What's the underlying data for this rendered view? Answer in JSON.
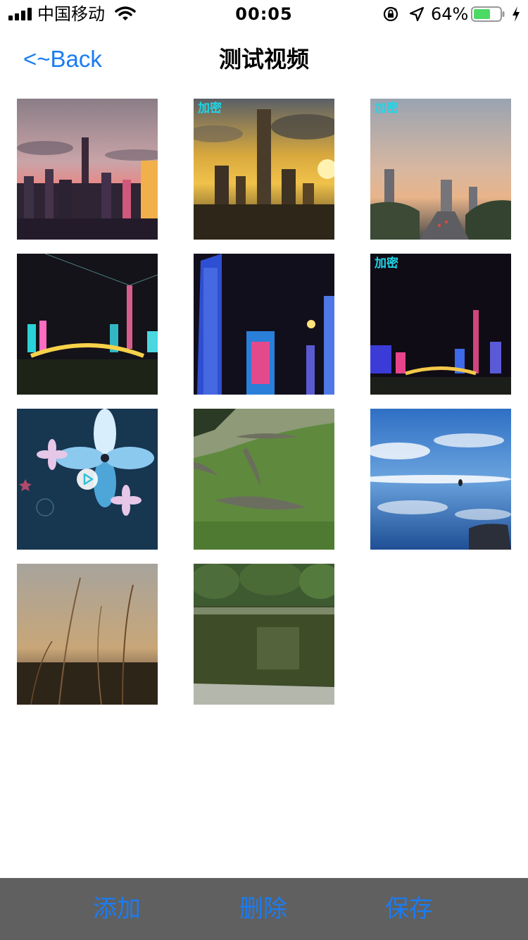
{
  "status_bar": {
    "carrier": "中国移动",
    "time": "00:05",
    "battery_percent": "64%",
    "battery_level": 0.64,
    "icons": [
      "signal-icon",
      "wifi-icon",
      "rotation-lock-icon",
      "location-icon",
      "battery-icon",
      "charging-icon"
    ]
  },
  "nav": {
    "back_label": "<~Back",
    "title": "测试视频"
  },
  "grid": {
    "items": [
      {
        "badge": ""
      },
      {
        "badge": "加密"
      },
      {
        "badge": "加密"
      },
      {
        "badge": ""
      },
      {
        "badge": ""
      },
      {
        "badge": "加密"
      },
      {
        "badge": "",
        "play_icon": "play-icon"
      },
      {
        "badge": ""
      },
      {
        "badge": ""
      },
      {
        "badge": ""
      },
      {
        "badge": ""
      }
    ]
  },
  "toolbar": {
    "add_label": "添加",
    "delete_label": "删除",
    "save_label": "保存"
  },
  "colors": {
    "accent": "#1a7cf2",
    "badge": "#1fd5e8",
    "toolbar_bg": "#606060"
  }
}
